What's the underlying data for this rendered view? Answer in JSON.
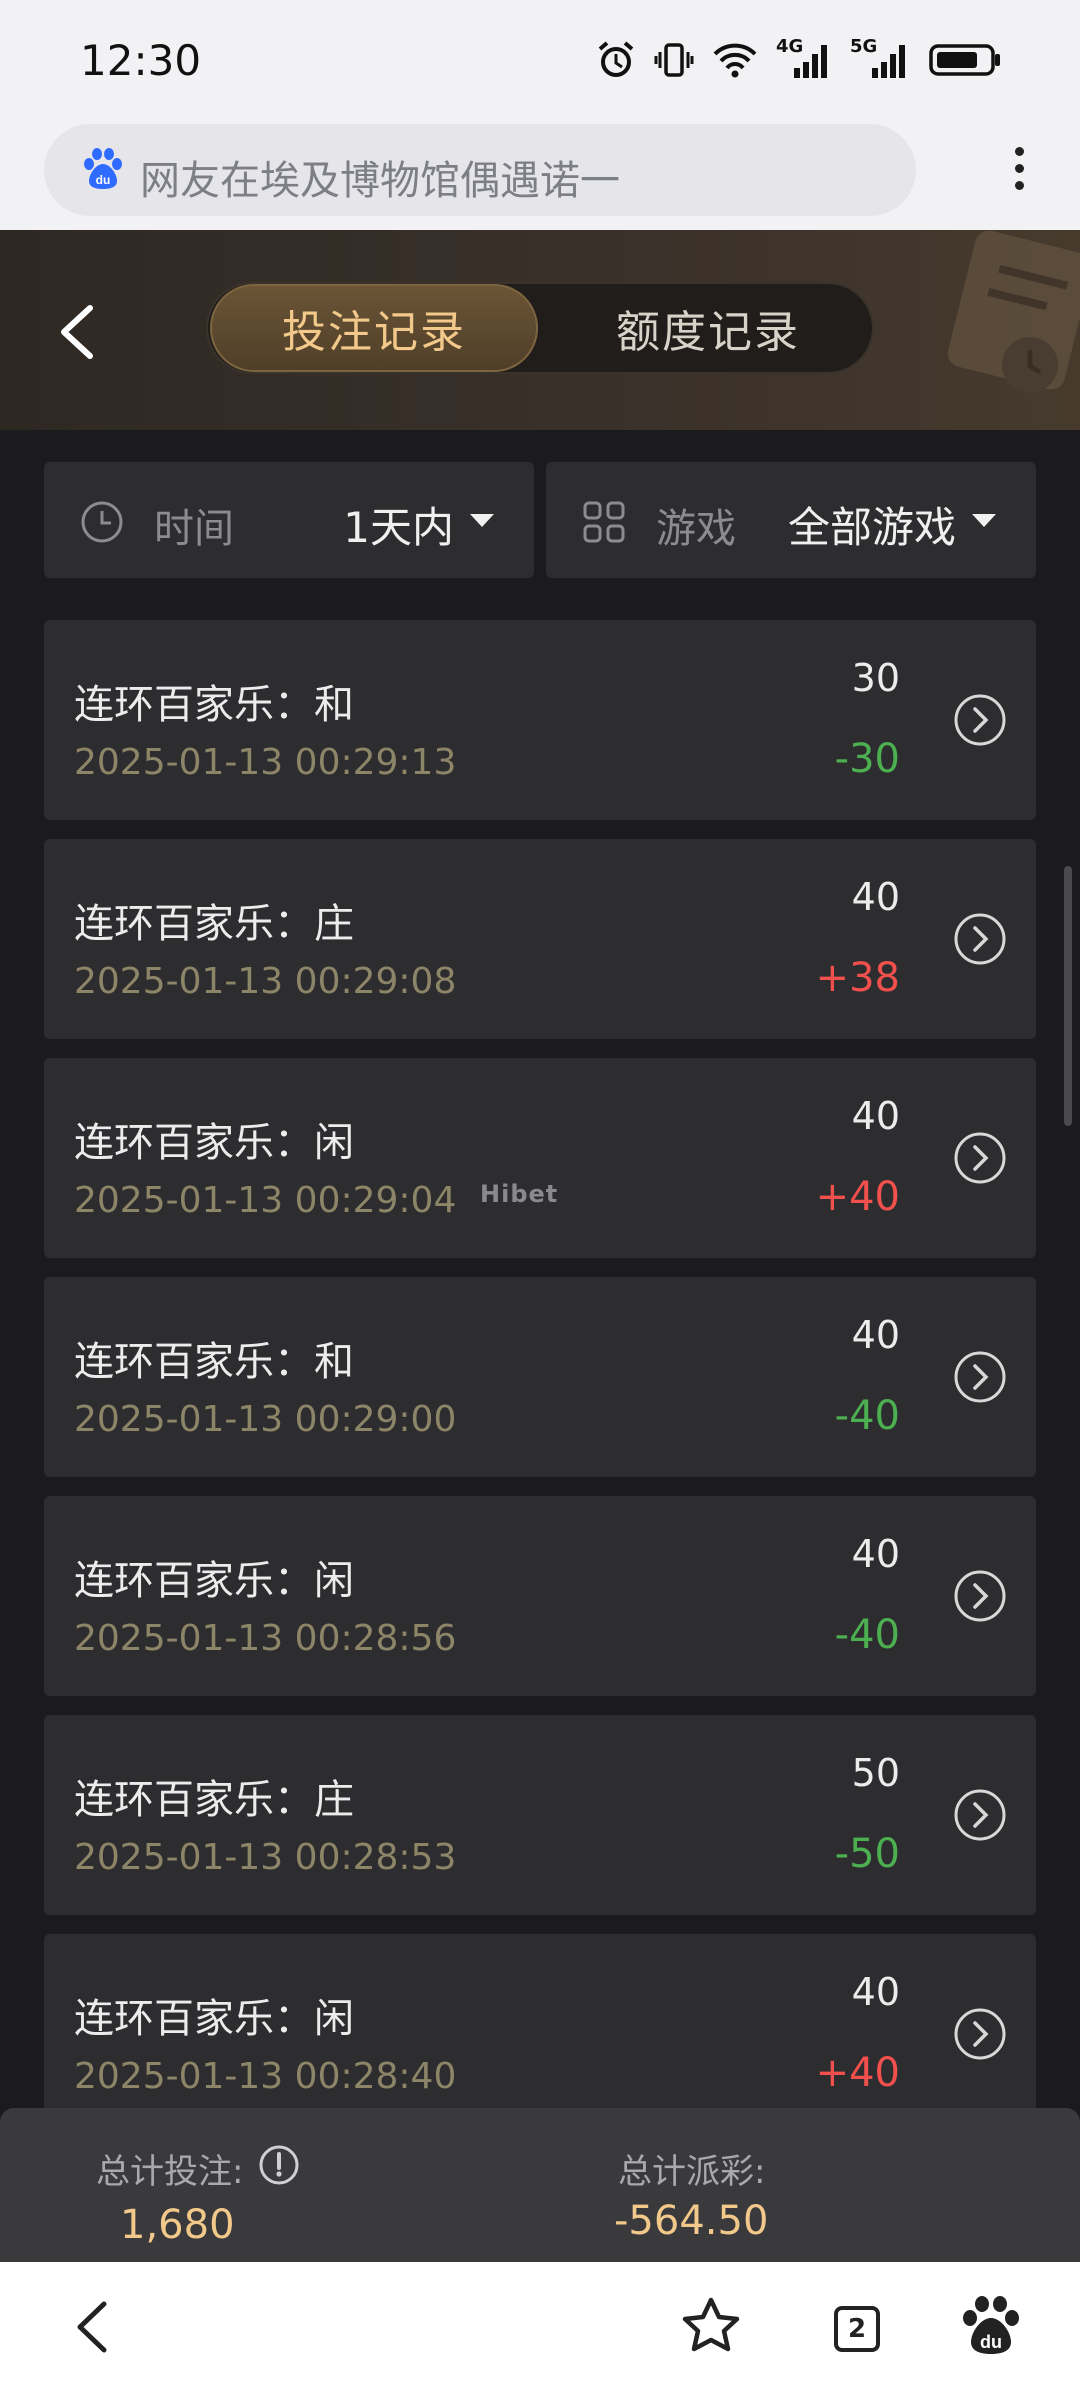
{
  "status": {
    "time": "12:30",
    "net1": "4G",
    "net2": "5G"
  },
  "browser": {
    "query": "网友在埃及博物馆偶遇诺一"
  },
  "header": {
    "tab_bets": "投注记录",
    "tab_quota": "额度记录"
  },
  "filters": {
    "time_label": "时间",
    "time_value": "1天内",
    "game_label": "游戏",
    "game_value": "全部游戏"
  },
  "records": [
    {
      "title": "连环百家乐：和",
      "time": "2025-01-13 00:29:13",
      "bet": "30",
      "payout": "-30"
    },
    {
      "title": "连环百家乐：庄",
      "time": "2025-01-13 00:29:08",
      "bet": "40",
      "payout": "+38"
    },
    {
      "title": "连环百家乐：闲",
      "time": "2025-01-13 00:29:04",
      "bet": "40",
      "payout": "+40"
    },
    {
      "title": "连环百家乐：和",
      "time": "2025-01-13 00:29:00",
      "bet": "40",
      "payout": "-40"
    },
    {
      "title": "连环百家乐：闲",
      "time": "2025-01-13 00:28:56",
      "bet": "40",
      "payout": "-40"
    },
    {
      "title": "连环百家乐：庄",
      "time": "2025-01-13 00:28:53",
      "bet": "50",
      "payout": "-50"
    },
    {
      "title": "连环百家乐：闲",
      "time": "2025-01-13 00:28:40",
      "bet": "40",
      "payout": "+40"
    }
  ],
  "watermark": "Hibet",
  "summary": {
    "total_bet_label": "总计投注:",
    "total_bet_value": "1,680",
    "total_payout_label": "总计派彩:",
    "total_payout_value": "-564.50"
  },
  "nav": {
    "tabs_count": "2"
  },
  "colors": {
    "accent_gold": "#f2c98a",
    "loss_green": "#4caf50",
    "win_red": "#f2504d"
  }
}
